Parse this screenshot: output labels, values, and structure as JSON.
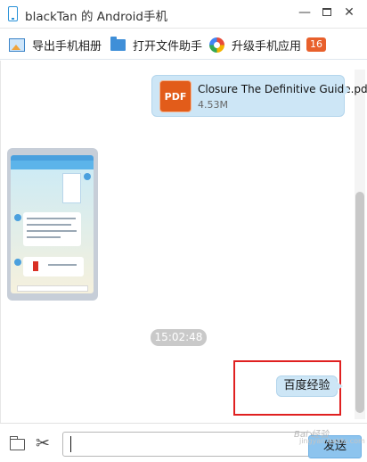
{
  "window": {
    "title": "blackTan 的 Android手机",
    "min_label": "—",
    "close_label": "✕"
  },
  "toolbar": {
    "export_album": "导出手机相册",
    "open_file_helper": "打开文件助手",
    "upgrade_apps": "升级手机应用",
    "upgrade_count": "16"
  },
  "messages": {
    "file": {
      "icon_label": "PDF",
      "name": "Closure The Definitive Guide.pdf",
      "size": "4.53M"
    },
    "time": "15:02:48",
    "text": "百度经验"
  },
  "input": {
    "value": "",
    "send_label": "发送",
    "scissors_icon": "✂"
  },
  "watermark": {
    "text": "Bai 经验",
    "url": "jingyan.baidu.com"
  },
  "colors": {
    "bubble": "#cde6f6",
    "accent": "#2a92d8",
    "highlight": "#e02020",
    "badge": "#e8602c"
  }
}
